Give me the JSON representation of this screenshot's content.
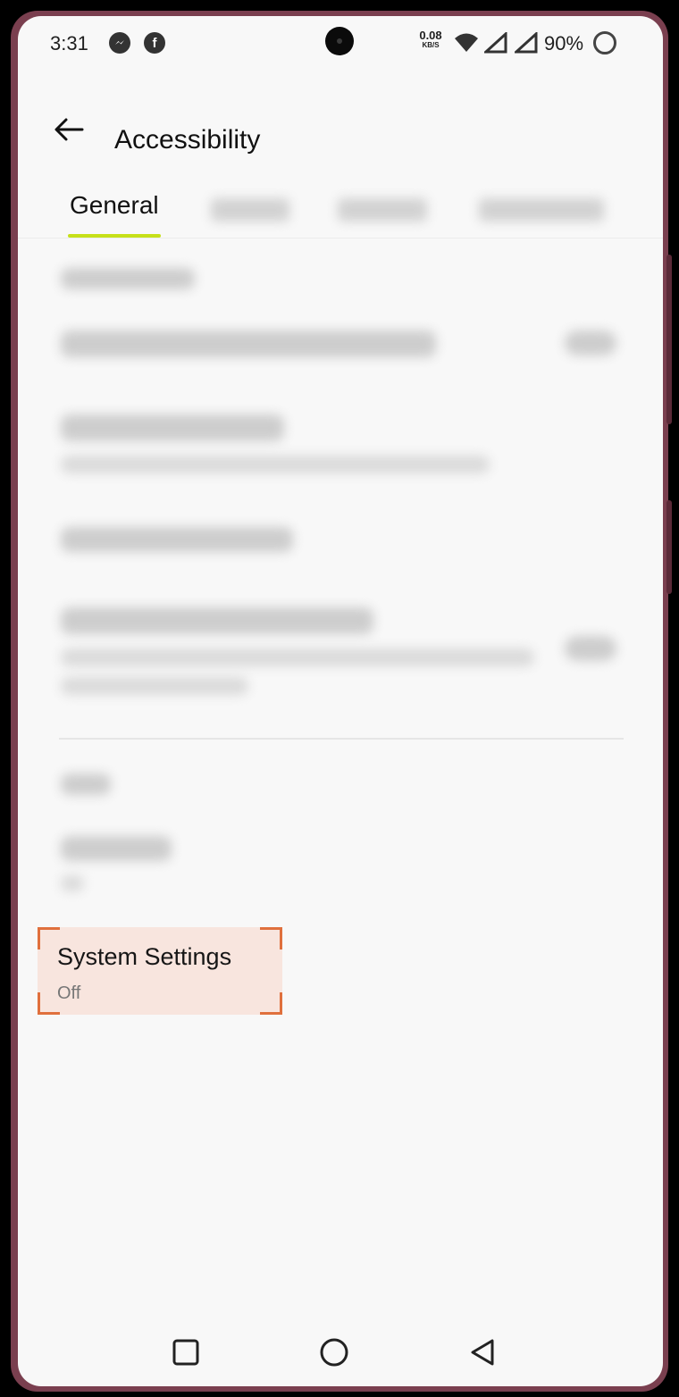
{
  "status_bar": {
    "time": "3:31",
    "notification_icons": [
      "messenger-icon",
      "facebook-icon"
    ],
    "net_speed_value": "0.08",
    "net_speed_unit": "KB/S",
    "battery_percent": "90%"
  },
  "header": {
    "title": "Accessibility",
    "back_icon": "arrow-left-icon"
  },
  "tabs": {
    "active_label": "General",
    "accent_color": "#c6e01a"
  },
  "system_settings": {
    "title": "System Settings",
    "value": "Off",
    "highlight_color": "#e0703d"
  },
  "nav_bar": {
    "icons": [
      "recents-square-icon",
      "home-circle-icon",
      "back-triangle-icon"
    ]
  }
}
